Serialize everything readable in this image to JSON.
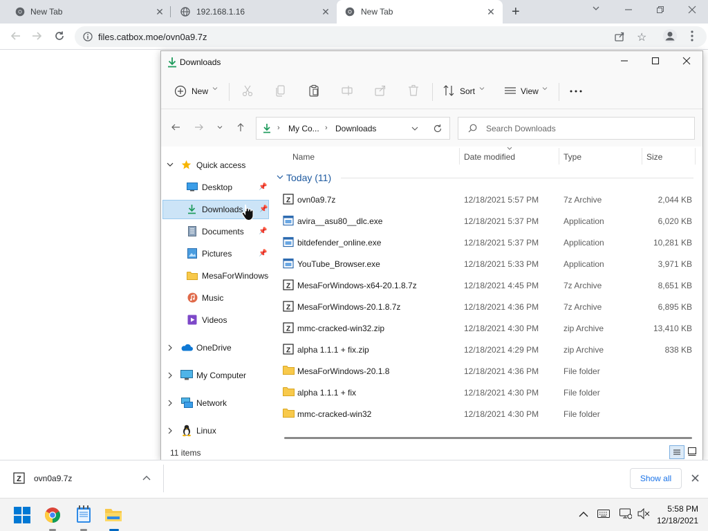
{
  "browser": {
    "tabs": [
      {
        "title": "New Tab",
        "active": false
      },
      {
        "title": "192.168.1.16",
        "active": false
      },
      {
        "title": "New Tab",
        "active": true
      }
    ],
    "url": "files.catbox.moe/ovn0a9.7z"
  },
  "explorer": {
    "title": "Downloads",
    "commands": {
      "new": "New",
      "sort": "Sort",
      "view": "View"
    },
    "breadcrumb": [
      "My Co...",
      "Downloads"
    ],
    "search_placeholder": "Search Downloads",
    "nav": {
      "quick_access": "Quick access",
      "items": [
        {
          "label": "Desktop",
          "icon": "desktop-icon",
          "pinned": true
        },
        {
          "label": "Downloads",
          "icon": "download-icon",
          "pinned": true,
          "selected": true
        },
        {
          "label": "Documents",
          "icon": "documents-icon",
          "pinned": true
        },
        {
          "label": "Pictures",
          "icon": "pictures-icon",
          "pinned": true
        },
        {
          "label": "MesaForWindows-",
          "icon": "folder-icon",
          "pinned": false
        },
        {
          "label": "Music",
          "icon": "music-icon",
          "pinned": false
        },
        {
          "label": "Videos",
          "icon": "videos-icon",
          "pinned": false
        }
      ],
      "roots": [
        {
          "label": "OneDrive",
          "icon": "onedrive-icon"
        },
        {
          "label": "My Computer",
          "icon": "computer-icon"
        },
        {
          "label": "Network",
          "icon": "network-icon"
        },
        {
          "label": "Linux",
          "icon": "linux-icon"
        }
      ]
    },
    "columns": {
      "name": "Name",
      "date": "Date modified",
      "type": "Type",
      "size": "Size"
    },
    "group_label": "Today (11)",
    "files": [
      {
        "name": "ovn0a9.7z",
        "date": "12/18/2021 5:57 PM",
        "type": "7z Archive",
        "size": "2,044 KB",
        "icon": "archive-icon"
      },
      {
        "name": "avira__asu80__dlc.exe",
        "date": "12/18/2021 5:37 PM",
        "type": "Application",
        "size": "6,020 KB",
        "icon": "app-icon"
      },
      {
        "name": "bitdefender_online.exe",
        "date": "12/18/2021 5:37 PM",
        "type": "Application",
        "size": "10,281 KB",
        "icon": "app-icon"
      },
      {
        "name": "YouTube_Browser.exe",
        "date": "12/18/2021 5:33 PM",
        "type": "Application",
        "size": "3,971 KB",
        "icon": "app-icon"
      },
      {
        "name": "MesaForWindows-x64-20.1.8.7z",
        "date": "12/18/2021 4:45 PM",
        "type": "7z Archive",
        "size": "8,651 KB",
        "icon": "archive-icon"
      },
      {
        "name": "MesaForWindows-20.1.8.7z",
        "date": "12/18/2021 4:36 PM",
        "type": "7z Archive",
        "size": "6,895 KB",
        "icon": "archive-icon"
      },
      {
        "name": "mmc-cracked-win32.zip",
        "date": "12/18/2021 4:30 PM",
        "type": "zip Archive",
        "size": "13,410 KB",
        "icon": "archive-icon"
      },
      {
        "name": "alpha 1.1.1 + fix.zip",
        "date": "12/18/2021 4:29 PM",
        "type": "zip Archive",
        "size": "838 KB",
        "icon": "archive-icon"
      },
      {
        "name": "MesaForWindows-20.1.8",
        "date": "12/18/2021 4:36 PM",
        "type": "File folder",
        "size": "",
        "icon": "folder-icon"
      },
      {
        "name": "alpha 1.1.1 + fix",
        "date": "12/18/2021 4:30 PM",
        "type": "File folder",
        "size": "",
        "icon": "folder-icon"
      },
      {
        "name": "mmc-cracked-win32",
        "date": "12/18/2021 4:30 PM",
        "type": "File folder",
        "size": "",
        "icon": "folder-icon"
      }
    ],
    "status": "11 items"
  },
  "download_bar": {
    "file": "ovn0a9.7z",
    "show_all": "Show all"
  },
  "taskbar": {
    "time": "5:58 PM",
    "date": "12/18/2021"
  },
  "colors": {
    "accent": "#0067c0",
    "folder": "#f8c94b",
    "selected": "#cce4f7",
    "download_green": "#1d9a5b"
  }
}
